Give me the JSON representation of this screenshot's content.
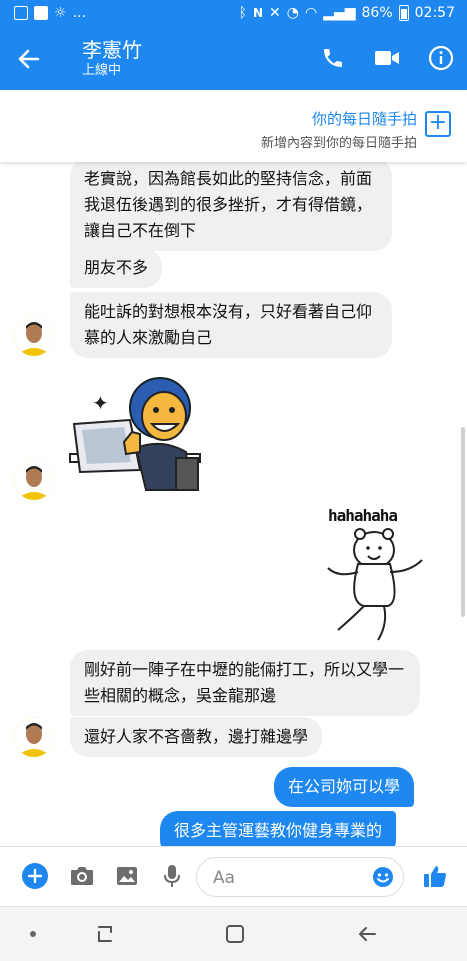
{
  "status_bar": {
    "dots": "...",
    "battery": "86%",
    "time": "02:57"
  },
  "header": {
    "contact_name": "李憲竹",
    "presence": "上線中",
    "icons": [
      "back-arrow-icon",
      "phone-icon",
      "video-camera-icon",
      "info-icon"
    ]
  },
  "story_banner": {
    "title": "你的每日隨手拍",
    "subtitle": "新增內容到你的每日隨手拍"
  },
  "messages": [
    {
      "sender": "contact",
      "text": "老實說，因為館長如此的堅持信念，前面我退伍後遇到的很多挫折，才有得借鏡，讓自己不在倒下"
    },
    {
      "sender": "contact",
      "text": "朋友不多"
    },
    {
      "sender": "contact",
      "text": "能吐訴的對想根本沒有，只好看著自己仰慕的人來激勵自己"
    },
    {
      "sender": "contact",
      "type": "sticker",
      "sticker": "thumbs-up-laptop-guy"
    },
    {
      "sender": "me",
      "type": "sticker",
      "sticker": "dancing-bear",
      "caption": "hahahaha"
    },
    {
      "sender": "contact",
      "text": "剛好前一陣子在中壢的能倆打工，所以又學一些相關的概念，吳金龍那邊"
    },
    {
      "sender": "contact",
      "text": "還好人家不吝嗇教，邊打雜邊學"
    },
    {
      "sender": "me",
      "text": "在公司妳可以學"
    },
    {
      "sender": "me",
      "text": "很多主管運藝教你健身專業的"
    }
  ],
  "composer": {
    "placeholder": "Aa",
    "icons": [
      "plus-icon",
      "camera-icon",
      "image-icon",
      "mic-icon",
      "emoji-icon",
      "thumbs-up-icon"
    ]
  },
  "colors": {
    "brand": "#1e88f0",
    "bubble_incoming": "#f0f0f0",
    "bubble_outgoing": "#1e88f0"
  }
}
